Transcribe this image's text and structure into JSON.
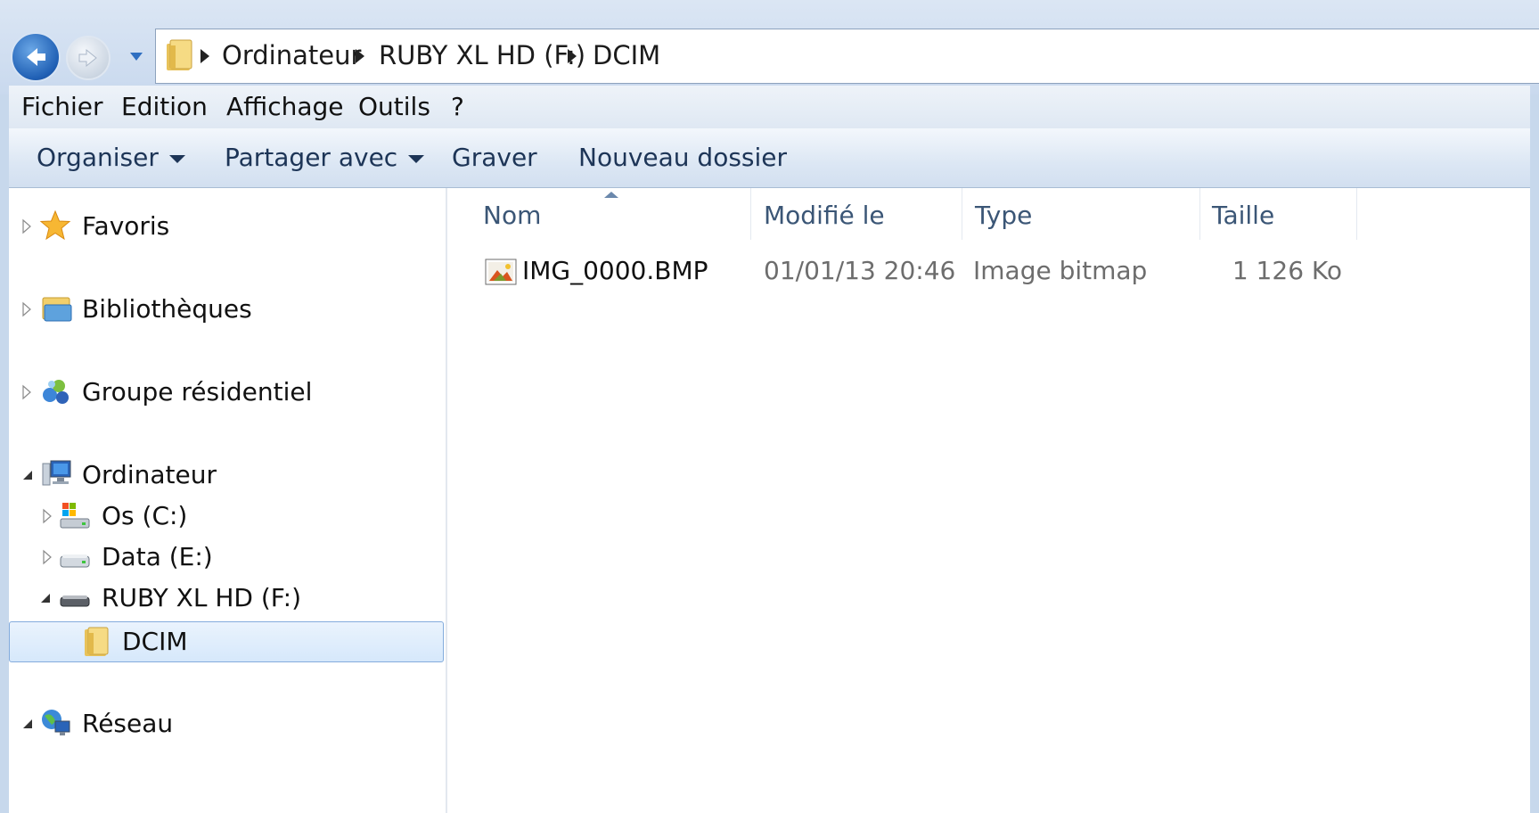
{
  "address_bar": {
    "crumbs": [
      "Ordinateur",
      "RUBY XL HD (F:)",
      "DCIM"
    ]
  },
  "menu": {
    "items": [
      "Fichier",
      "Edition",
      "Affichage",
      "Outils",
      "?"
    ]
  },
  "toolbar": {
    "organize": "Organiser",
    "share": "Partager avec",
    "burn": "Graver",
    "new_folder": "Nouveau dossier"
  },
  "nav": {
    "favorites": "Favoris",
    "libraries": "Bibliothèques",
    "homegroup": "Groupe résidentiel",
    "computer": "Ordinateur",
    "drive_c": "Os (C:)",
    "drive_e": "Data (E:)",
    "drive_f": "RUBY XL HD (F:)",
    "dcim": "DCIM",
    "network": "Réseau"
  },
  "columns": {
    "name": "Nom",
    "modified": "Modifié le",
    "type": "Type",
    "size": "Taille"
  },
  "files": [
    {
      "name": "IMG_0000.BMP",
      "modified": "01/01/13 20:46",
      "type": "Image bitmap",
      "size": "1 126 Ko",
      "icon": "bitmap-image-icon"
    }
  ],
  "colors": {
    "chrome": "#c7d8ec",
    "selection_border": "#84acdd",
    "command_text": "#1d3557",
    "header_text": "#3b5676"
  }
}
